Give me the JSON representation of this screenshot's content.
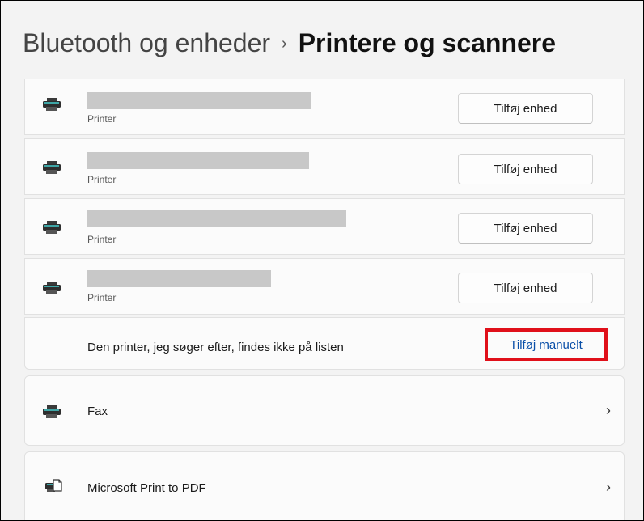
{
  "breadcrumb": {
    "parent": "Bluetooth og enheder",
    "separator": "›",
    "current": "Printere og scannere"
  },
  "printers": [
    {
      "subtitle": "Printer",
      "button_label": "Tilføj enhed",
      "icon": "printer-icon"
    },
    {
      "subtitle": "Printer",
      "button_label": "Tilføj enhed",
      "icon": "printer-icon"
    },
    {
      "subtitle": "Printer",
      "button_label": "Tilføj enhed",
      "icon": "printer-icon"
    },
    {
      "subtitle": "Printer",
      "button_label": "Tilføj enhed",
      "icon": "printer-icon"
    }
  ],
  "missing_printer": {
    "text": "Den printer, jeg søger efter, findes ikke på listen",
    "link_label": "Tilføj manuelt",
    "highlight_color": "#e0101a",
    "link_color": "#0a4fa8"
  },
  "devices": [
    {
      "label": "Fax",
      "icon": "printer-icon",
      "chevron": "›"
    },
    {
      "label": "Microsoft Print to PDF",
      "icon": "pdf-printer-icon",
      "chevron": "›"
    }
  ]
}
